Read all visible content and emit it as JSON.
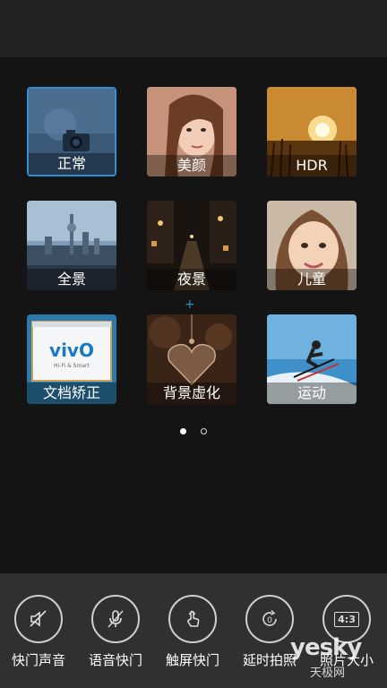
{
  "modes": [
    {
      "label": "正常",
      "selected": true
    },
    {
      "label": "美颜",
      "selected": false
    },
    {
      "label": "HDR",
      "selected": false
    },
    {
      "label": "全景",
      "selected": false
    },
    {
      "label": "夜景",
      "selected": false
    },
    {
      "label": "儿童",
      "selected": false
    },
    {
      "label": "文档矫正",
      "selected": false
    },
    {
      "label": "背景虚化",
      "selected": false
    },
    {
      "label": "运动",
      "selected": false
    }
  ],
  "doc_logo": "vivO",
  "doc_sub": "Hi-Fi & Smart",
  "pager": {
    "current_page": 1,
    "page_count": 2
  },
  "toolbar": [
    {
      "label": "快门声音",
      "icon": "speaker-muted-icon"
    },
    {
      "label": "语音快门",
      "icon": "microphone-icon"
    },
    {
      "label": "触屏快门",
      "icon": "touch-hand-icon"
    },
    {
      "label": "延时拍照",
      "icon": "timer-icon"
    },
    {
      "label": "照片大小",
      "icon": "aspect-ratio-icon",
      "badge": "4:3"
    }
  ],
  "watermark": {
    "logo": "yesky",
    "sub": "天极网"
  },
  "colors": {
    "accent": "#2d8fd5",
    "background": "#141414",
    "toolbar_bg": "#303030"
  }
}
